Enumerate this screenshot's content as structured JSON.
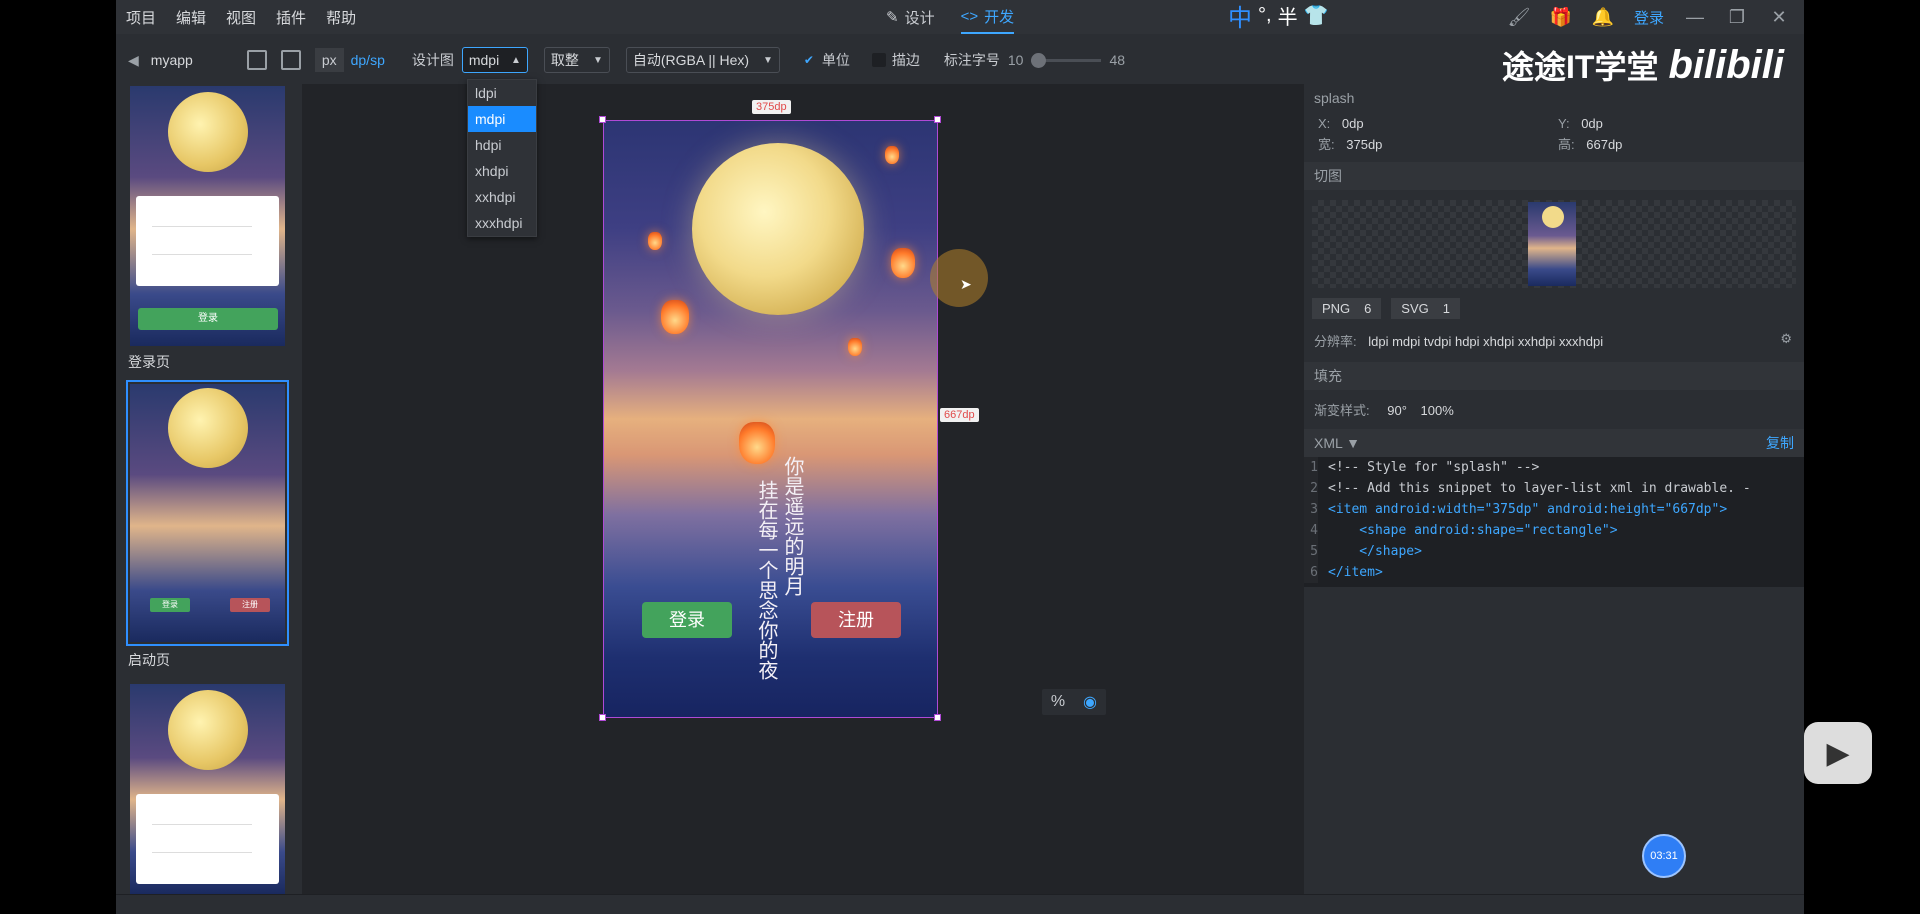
{
  "menu": [
    "项目",
    "编辑",
    "视图",
    "插件",
    "帮助"
  ],
  "modes": [
    {
      "label": "设计",
      "icon": "pencil-icon"
    },
    {
      "label": "开发",
      "icon": "code-icon"
    }
  ],
  "ime": {
    "glyph": "中",
    "mark": "°,",
    "half": "半"
  },
  "login_link": "登录",
  "watermark": {
    "school": "途途IT学堂",
    "site": "bilibili"
  },
  "toolbar": {
    "project": "myapp",
    "units": [
      "px",
      "dp/sp"
    ],
    "design_label": "设计图",
    "density_value": "mdpi",
    "rounding_value": "取整",
    "color_format": "自动(RGBA || Hex)",
    "unit_checkbox": "单位",
    "stroke_checkbox": "描边",
    "font_size_label": "标注字号",
    "font_min": "10",
    "font_max": "48"
  },
  "density_options": [
    "ldpi",
    "mdpi",
    "hdpi",
    "xhdpi",
    "xxhdpi",
    "xxxhdpi"
  ],
  "density_selected": "mdpi",
  "pages": [
    {
      "label": "登录页",
      "button": "登录"
    },
    {
      "label": "启动页",
      "buttons": [
        "登录",
        "注册"
      ]
    },
    {
      "label": "",
      "button": ""
    }
  ],
  "artboard": {
    "width_badge": "375dp",
    "height_badge": "667dp",
    "poem_line1": "你是遥远的明月",
    "poem_line2": "挂在每一个思念你的夜",
    "login_btn": "登录",
    "register_btn": "注册"
  },
  "props": {
    "name": "splash",
    "x_label": "X:",
    "x_value": "0dp",
    "y_label": "Y:",
    "y_value": "0dp",
    "w_label": "宽:",
    "w_value": "375dp",
    "h_label": "高:",
    "h_value": "667dp",
    "slice_title": "切图",
    "png_label": "PNG",
    "png_count": "6",
    "svg_label": "SVG",
    "svg_count": "1",
    "resolution_label": "分辨率:",
    "resolution_value": "ldpi mdpi tvdpi hdpi xhdpi xxhdpi xxxhdpi",
    "fill_title": "填充",
    "gradient_label": "渐变样式:",
    "gradient_angle": "90°",
    "gradient_pct": "100%",
    "xml_label": "XML",
    "copy_label": "复制"
  },
  "xml_lines": [
    "<!-- Style for \"splash\" -->",
    "<!-- Add this snippet to layer-list xml in drawable. -",
    "<item android:width=\"375dp\" android:height=\"667dp\">",
    "    <shape android:shape=\"rectangle\">",
    "    </shape>",
    "</item>"
  ],
  "video_time": "03:31",
  "colors": {
    "accent": "#3ea7ff",
    "green": "#43a35c",
    "red": "#b7545a",
    "selection": "#b04ad6"
  }
}
